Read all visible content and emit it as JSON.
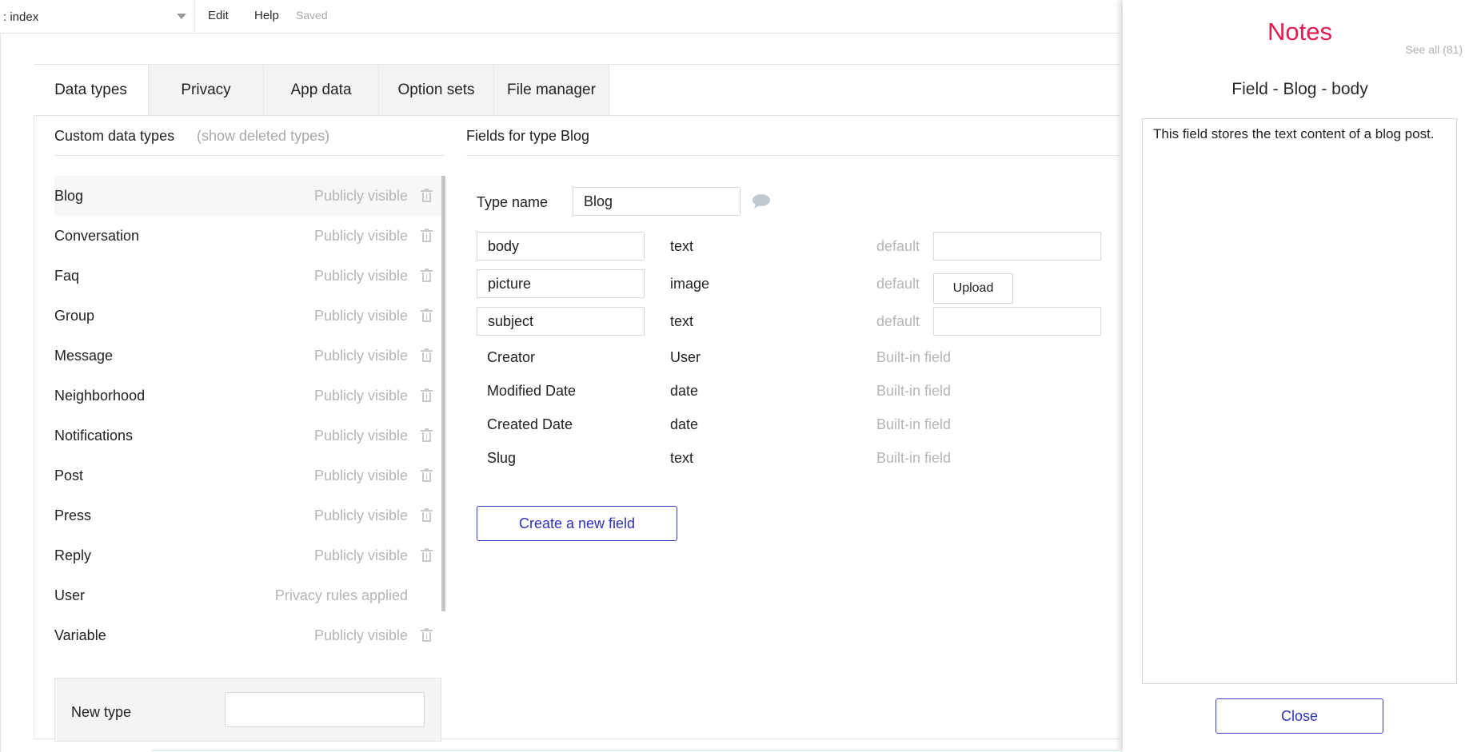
{
  "topbar": {
    "page_name": ": index",
    "menu_edit": "Edit",
    "menu_help": "Help",
    "status": "Saved"
  },
  "tabs": [
    {
      "label": "Data types",
      "active": true
    },
    {
      "label": "Privacy",
      "active": false
    },
    {
      "label": "App data",
      "active": false
    },
    {
      "label": "Option sets",
      "active": false
    },
    {
      "label": "File manager",
      "active": false
    }
  ],
  "custom_types": {
    "title": "Custom data types",
    "show_deleted": "(show deleted types)",
    "items": [
      {
        "name": "Blog",
        "visibility": "Publicly visible",
        "selected": true,
        "deletable": true
      },
      {
        "name": "Conversation",
        "visibility": "Publicly visible",
        "selected": false,
        "deletable": true
      },
      {
        "name": "Faq",
        "visibility": "Publicly visible",
        "selected": false,
        "deletable": true
      },
      {
        "name": "Group",
        "visibility": "Publicly visible",
        "selected": false,
        "deletable": true
      },
      {
        "name": "Message",
        "visibility": "Publicly visible",
        "selected": false,
        "deletable": true
      },
      {
        "name": "Neighborhood",
        "visibility": "Publicly visible",
        "selected": false,
        "deletable": true
      },
      {
        "name": "Notifications",
        "visibility": "Publicly visible",
        "selected": false,
        "deletable": true
      },
      {
        "name": "Post",
        "visibility": "Publicly visible",
        "selected": false,
        "deletable": true
      },
      {
        "name": "Press",
        "visibility": "Publicly visible",
        "selected": false,
        "deletable": true
      },
      {
        "name": "Reply",
        "visibility": "Publicly visible",
        "selected": false,
        "deletable": true
      },
      {
        "name": "User",
        "visibility": "Privacy rules applied",
        "selected": false,
        "deletable": false
      },
      {
        "name": "Variable",
        "visibility": "Publicly visible",
        "selected": false,
        "deletable": true
      }
    ],
    "new_type_label": "New type",
    "new_type_value": ""
  },
  "fields_panel": {
    "title": "Fields for type Blog",
    "type_name_label": "Type name",
    "type_name_value": "Blog",
    "custom_fields": [
      {
        "name": "body",
        "type": "text",
        "default_label": "default",
        "control": "input",
        "default_value": ""
      },
      {
        "name": "picture",
        "type": "image",
        "default_label": "default",
        "control": "upload",
        "upload_label": "Upload"
      },
      {
        "name": "subject",
        "type": "text",
        "default_label": "default",
        "control": "input",
        "default_value": ""
      }
    ],
    "builtin_fields": [
      {
        "name": "Creator",
        "type": "User",
        "note": "Built-in field"
      },
      {
        "name": "Modified Date",
        "type": "date",
        "note": "Built-in field"
      },
      {
        "name": "Created Date",
        "type": "date",
        "note": "Built-in field"
      },
      {
        "name": "Slug",
        "type": "text",
        "note": "Built-in field"
      }
    ],
    "create_button": "Create a new field"
  },
  "notes": {
    "title": "Notes",
    "see_all": "See all (81)",
    "subject": "Field - Blog - body",
    "body": "This field stores the text content of a blog post.",
    "close_button": "Close"
  },
  "colors": {
    "accent": "#2e30b8",
    "notes_title": "#e41b4f",
    "muted_text": "#b5b5b5"
  }
}
